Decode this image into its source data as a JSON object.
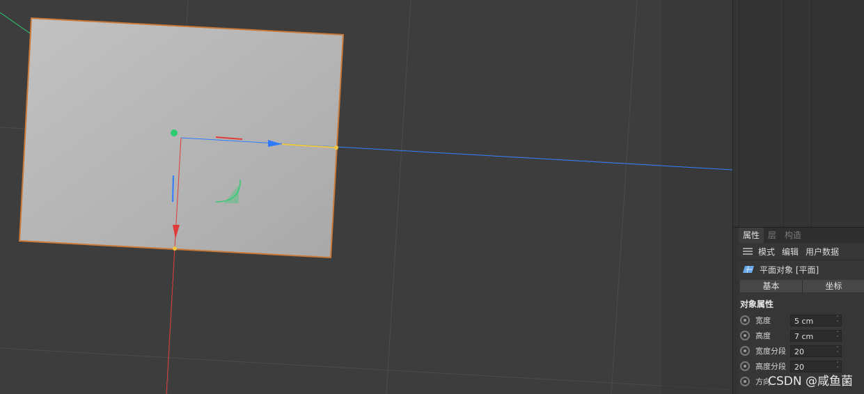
{
  "attributes": {
    "tabs": [
      "属性",
      "层",
      "构造"
    ],
    "menu": [
      "模式",
      "编辑",
      "用户数据"
    ],
    "object_title": "平面对象 [平面]",
    "buttons": [
      "基本",
      "坐标"
    ],
    "section_title": "对象属性",
    "properties": [
      {
        "label": "宽度",
        "value": "5 cm"
      },
      {
        "label": "高度",
        "value": "7 cm"
      },
      {
        "label": "宽度分段",
        "value": "20"
      },
      {
        "label": "高度分段",
        "value": "20"
      },
      {
        "label": "方向",
        "value": ""
      }
    ]
  },
  "icons": {
    "menu": "hamburger-icon",
    "object": "plane-object-icon",
    "property": "animation-radio-icon",
    "spinner": "stepper-arrows-icon"
  },
  "colors": {
    "selection_outline": "#c97a3a",
    "axis_x": "#2f7bff",
    "axis_y": "#e03a3a",
    "axis_z": "#2ecc71",
    "plane_fill": "#b4b4b4"
  },
  "watermark": "CSDN @咸鱼菌"
}
